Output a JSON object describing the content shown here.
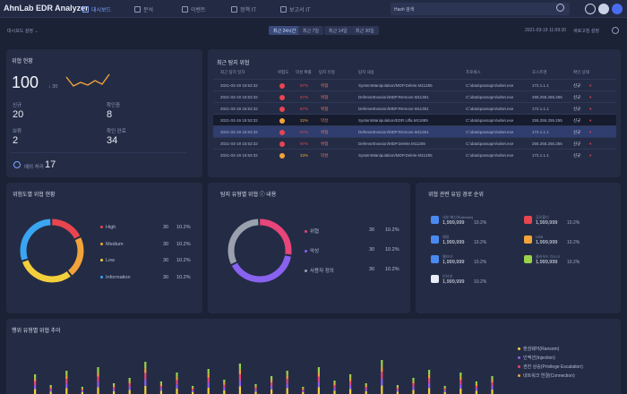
{
  "app": {
    "title": "AhnLab EDR Analyzer"
  },
  "nav": {
    "tabs": [
      {
        "label": "대시보드",
        "active": true
      },
      {
        "label": "분석"
      },
      {
        "label": "이벤트"
      },
      {
        "label": "정책 IT"
      },
      {
        "label": "보고서 IT"
      }
    ],
    "search_value": "Hash 검색"
  },
  "subbar": {
    "dashboard_setting": "대시보드 설정",
    "period_options": [
      "최근 24시간",
      "최근 7일",
      "최근 14일",
      "최근 30일"
    ],
    "active_period": 0,
    "updated_at": "2021-03-19 11:09:30",
    "refresh_label": "새로고침 설정"
  },
  "threat_status": {
    "title": "위협 현황",
    "total": "100",
    "total_delta": "↓ 30",
    "items": [
      {
        "label": "신규",
        "value": "20"
      },
      {
        "label": "확인중",
        "value": "8"
      },
      {
        "label": "보류",
        "value": "2"
      },
      {
        "label": "확인 완료",
        "value": "34"
      }
    ],
    "extra_label": "예외 처리",
    "extra_value": "17"
  },
  "recent_threats": {
    "title": "최근 탐지 위협",
    "columns": [
      "최근 탐지 일자",
      "위험도",
      "악성 확률",
      "탐지 유형",
      "탐지 내용",
      "프로세스",
      "호스트명",
      "확인 상태"
    ],
    "rows": [
      {
        "date": "2021-03-19 15:53:32",
        "risk": "high",
        "prob": "97%",
        "type": "위협",
        "content": "SystemManipulation/MDP.Delete.M11255",
        "process": "C:\\data\\passapm\\wbet.exe",
        "host": "172.1.1.1",
        "status": "신규"
      },
      {
        "date": "2021-03-19 15:53:32",
        "risk": "high",
        "prob": "67%",
        "type": "위협",
        "content": "DefenseEvasion/MDP.Remove.M11361",
        "process": "C:\\data\\passapm\\wbet.exe",
        "host": "255.255.255.255",
        "status": "신규"
      },
      {
        "date": "2021-03-19 15:53:32",
        "risk": "high",
        "prob": "67%",
        "type": "위협",
        "content": "DefenseEvasion/MDP.Remove.M11361",
        "process": "C:\\data\\passapm\\wbet.exe",
        "host": "172.1.1.1",
        "status": "신규"
      },
      {
        "date": "2021-03-19 15:53:32",
        "risk": "med",
        "prob": "32%",
        "type": "악성",
        "content": "SystemManipulation/EDR.Ulfa.M11889",
        "process": "C:\\data\\passapm\\wbet.exe",
        "host": "255.255.255.255",
        "status": "신규"
      },
      {
        "date": "2021-03-19 15:53:32",
        "risk": "high",
        "prob": "97%",
        "type": "위협",
        "content": "DefenseEvasion/MDP.Remove.M11361",
        "process": "C:\\data\\passapm\\wbet.exe",
        "host": "172.1.1.1",
        "status": "신규"
      },
      {
        "date": "2021-03-19 15:53:32",
        "risk": "high",
        "prob": "97%",
        "type": "위협",
        "content": "DefenseEvasion/MDP.Delete.M11255",
        "process": "C:\\data\\passapm\\wbet.exe",
        "host": "255.255.255.255",
        "status": "신규"
      },
      {
        "date": "2021-03-19 15:53:32",
        "risk": "med",
        "prob": "33%",
        "type": "악성",
        "content": "SystemManipulation/MDP.Delete.M11255",
        "process": "C:\\data\\passapm\\wbet.exe",
        "host": "172.1.1.1",
        "status": "신규"
      }
    ]
  },
  "risk_level": {
    "title": "위험도별 위협 현황",
    "items": [
      {
        "label": "High",
        "count": "30",
        "pct": "10.2%",
        "color": "#e8454f",
        "share": 0.18
      },
      {
        "label": "Medium",
        "count": "30",
        "pct": "10.2%",
        "color": "#f2a33a",
        "share": 0.22
      },
      {
        "label": "Low",
        "count": "30",
        "pct": "10.2%",
        "color": "#f4cf3c",
        "share": 0.3
      },
      {
        "label": "Information",
        "count": "30",
        "pct": "10.2%",
        "color": "#3aa6f2",
        "share": 0.3
      }
    ]
  },
  "detect_type": {
    "title": "탐지 유형별 위협 ⓘ 내용",
    "items": [
      {
        "label": "위협",
        "count": "30",
        "pct": "10.2%",
        "color": "#e8457a",
        "share": 0.28
      },
      {
        "label": "악성",
        "count": "30",
        "pct": "10.2%",
        "color": "#8a62f0",
        "share": 0.4
      },
      {
        "label": "사용자 정의",
        "count": "30",
        "pct": "10.2%",
        "color": "#9aa0ad",
        "share": 0.32
      }
    ]
  },
  "inflow_path": {
    "title": "위협 관련 유입 경로 순위",
    "left": [
      {
        "label": "내부 메신저(ahnlab)",
        "value": "1,999,999",
        "pct": "10.2%",
        "color": "#4a8af0"
      },
      {
        "label": "메일",
        "value": "1,999,999",
        "pct": "10.2%",
        "color": "#4a8af0"
      },
      {
        "label": "웹브라",
        "value": "1,999,999",
        "pct": "10.2%",
        "color": "#4a8af0"
      },
      {
        "label": "인터넷",
        "value": "1,999,999",
        "pct": "10.2%",
        "color": "#e8ecf7"
      }
    ],
    "right": [
      {
        "label": "공유폴더",
        "value": "1,999,999",
        "pct": "10.2%",
        "color": "#e8454f"
      },
      {
        "label": "USB",
        "value": "1,999,999",
        "pct": "10.2%",
        "color": "#f2a33a"
      },
      {
        "label": "클라우드 디스크",
        "value": "1,999,999",
        "pct": "10.2%",
        "color": "#9ad24a"
      }
    ]
  },
  "trend": {
    "title": "행위 유형별 위협 추이",
    "legend": [
      {
        "label": "랜섬웨어(Ransom)",
        "color": "#f4cf3c"
      },
      {
        "label": "인젝션(Injection)",
        "color": "#8a62f0"
      },
      {
        "label": "권한 상승(Privilege Escalation)",
        "color": "#e8457a"
      },
      {
        "label": "네트워크 연결(Connection)",
        "color": "#f2a33a"
      }
    ]
  },
  "colors": {
    "accent": "#7ea4ff",
    "high": "#e8454f",
    "medium": "#f2a33a"
  }
}
